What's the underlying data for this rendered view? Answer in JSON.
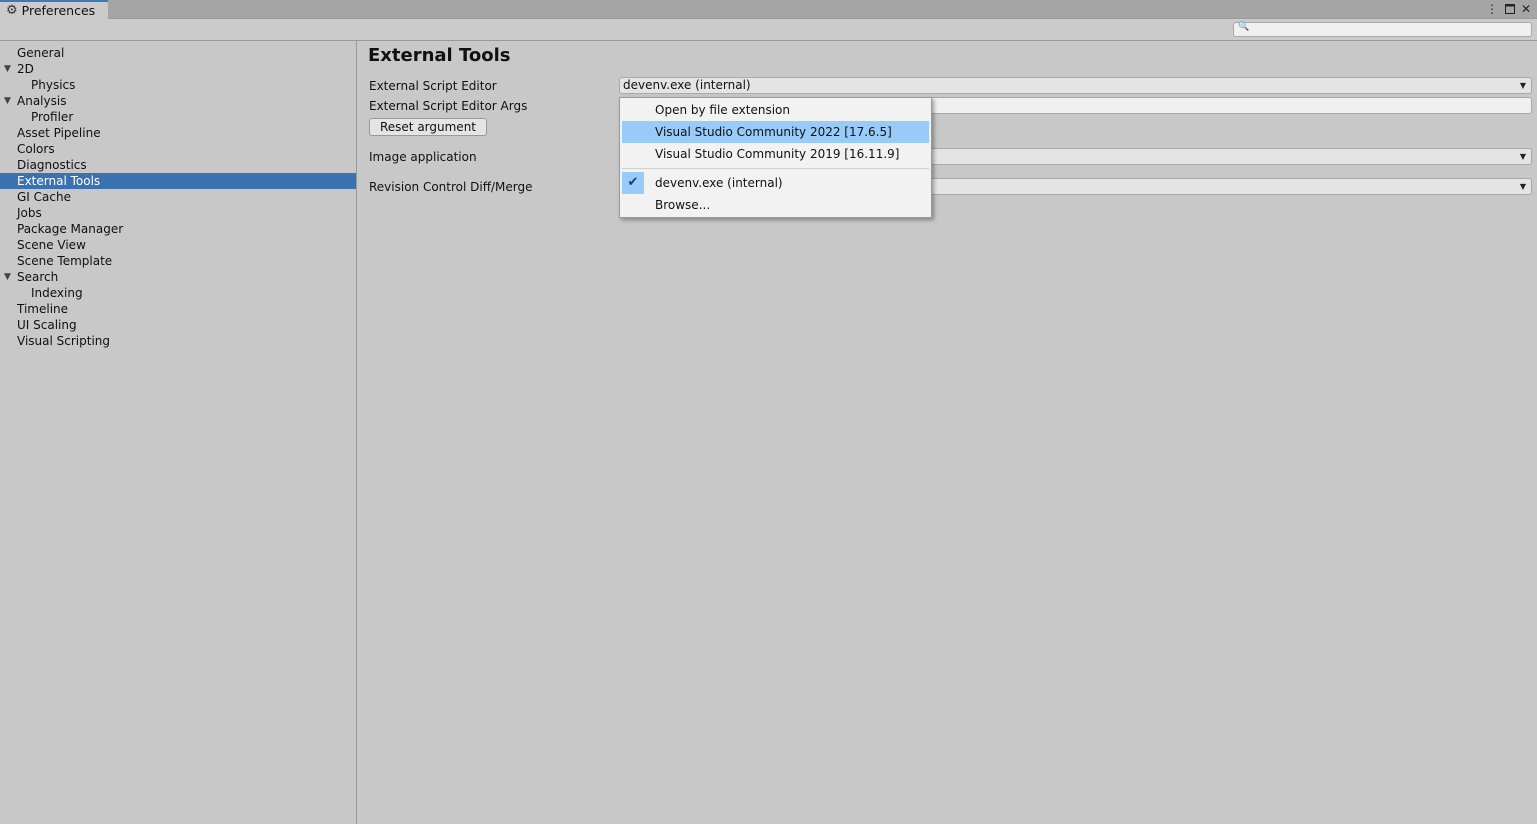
{
  "window": {
    "tab_title": "Preferences",
    "icon": "gear-icon",
    "controls": [
      "more-icon",
      "maximize-icon",
      "close-icon"
    ]
  },
  "search": {
    "placeholder": ""
  },
  "sidebar": {
    "items": [
      {
        "label": "General",
        "level": 0
      },
      {
        "label": "2D",
        "level": 0,
        "expanded": true
      },
      {
        "label": "Physics",
        "level": 1
      },
      {
        "label": "Analysis",
        "level": 0,
        "expanded": true
      },
      {
        "label": "Profiler",
        "level": 1
      },
      {
        "label": "Asset Pipeline",
        "level": 0
      },
      {
        "label": "Colors",
        "level": 0
      },
      {
        "label": "Diagnostics",
        "level": 0
      },
      {
        "label": "External Tools",
        "level": 0,
        "selected": true
      },
      {
        "label": "GI Cache",
        "level": 0
      },
      {
        "label": "Jobs",
        "level": 0
      },
      {
        "label": "Package Manager",
        "level": 0
      },
      {
        "label": "Scene View",
        "level": 0
      },
      {
        "label": "Scene Template",
        "level": 0
      },
      {
        "label": "Search",
        "level": 0,
        "expanded": true
      },
      {
        "label": "Indexing",
        "level": 1
      },
      {
        "label": "Timeline",
        "level": 0
      },
      {
        "label": "UI Scaling",
        "level": 0
      },
      {
        "label": "Visual Scripting",
        "level": 0
      }
    ]
  },
  "main": {
    "title": "External Tools",
    "external_script_editor_label": "External Script Editor",
    "external_script_editor_value": "devenv.exe (internal)",
    "external_script_editor_args_label": "External Script Editor Args",
    "reset_argument_label": "Reset argument",
    "image_application_label": "Image application",
    "revision_control_label": "Revision Control Diff/Merge"
  },
  "popup": {
    "items": [
      {
        "label": "Open by file extension"
      },
      {
        "label": "Visual Studio Community 2022 [17.6.5]",
        "highlighted": true
      },
      {
        "label": "Visual Studio Community 2019 [16.11.9]"
      },
      {
        "label": "devenv.exe (internal)",
        "checked": true
      },
      {
        "label": "Browse..."
      }
    ]
  },
  "colors": {
    "selection": "#3a72b0",
    "menu_highlight": "#99cbf8",
    "tab_accent": "#3a79bb"
  }
}
